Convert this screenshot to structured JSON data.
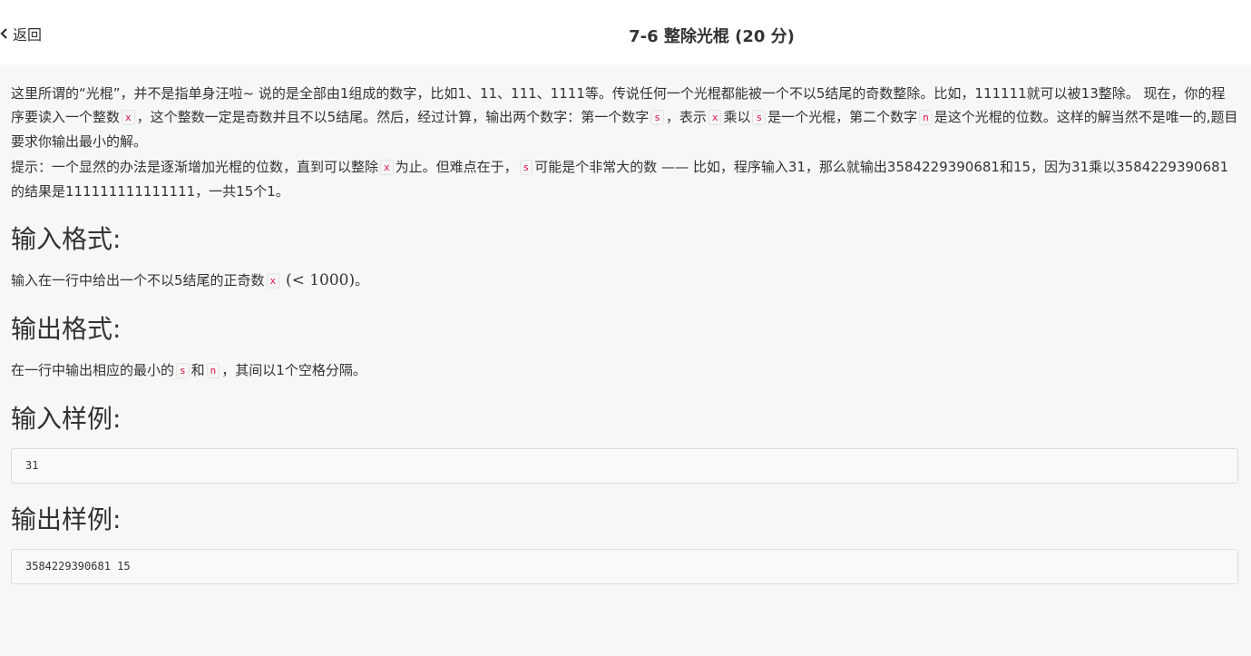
{
  "header": {
    "back_label": "返回",
    "title": "7-6 整除光棍 (20 分)"
  },
  "problem": {
    "desc1_a": "这里所谓的“光棍”，并不是指单身汪啦~ 说的是全部由1组成的数字，比如1、11、111、1111等。传说任何一个光棍都能被一个不以5结尾的奇数整除。比如，111111就可以被13整除。 现在，你的程序要读入一个整数",
    "desc1_b": "，这个整数一定是奇数并且不以5结尾。然后，经过计算，输出两个数字：第一个数字",
    "desc1_c": "，表示",
    "desc1_d": "乘以",
    "desc1_e": "是一个光棍，第二个数字",
    "desc1_f": "是这个光棍的位数。这样的解当然不是唯一的,题目要求你输出最小的解。",
    "desc2_a": "提示：一个显然的办法是逐渐增加光棍的位数，直到可以整除",
    "desc2_b": "为止。但难点在于，",
    "desc2_c": "可能是个非常大的数 —— 比如，程序输入31，那么就输出3584229390681和15，因为31乘以3584229390681的结果是111111111111111，一共15个1。",
    "var_x": "x",
    "var_s": "s",
    "var_n": "n"
  },
  "input_format": {
    "heading": "输入格式:",
    "text_a": "输入在一行中给出一个不以5结尾的正奇数",
    "math": "(< 1000)",
    "text_b": "。"
  },
  "output_format": {
    "heading": "输出格式:",
    "text_a": "在一行中输出相应的最小的",
    "text_b": "和",
    "text_c": "，其间以1个空格分隔。"
  },
  "sample_input": {
    "heading": "输入样例:",
    "value": "31"
  },
  "sample_output": {
    "heading": "输出样例:",
    "value": "3584229390681 15"
  }
}
